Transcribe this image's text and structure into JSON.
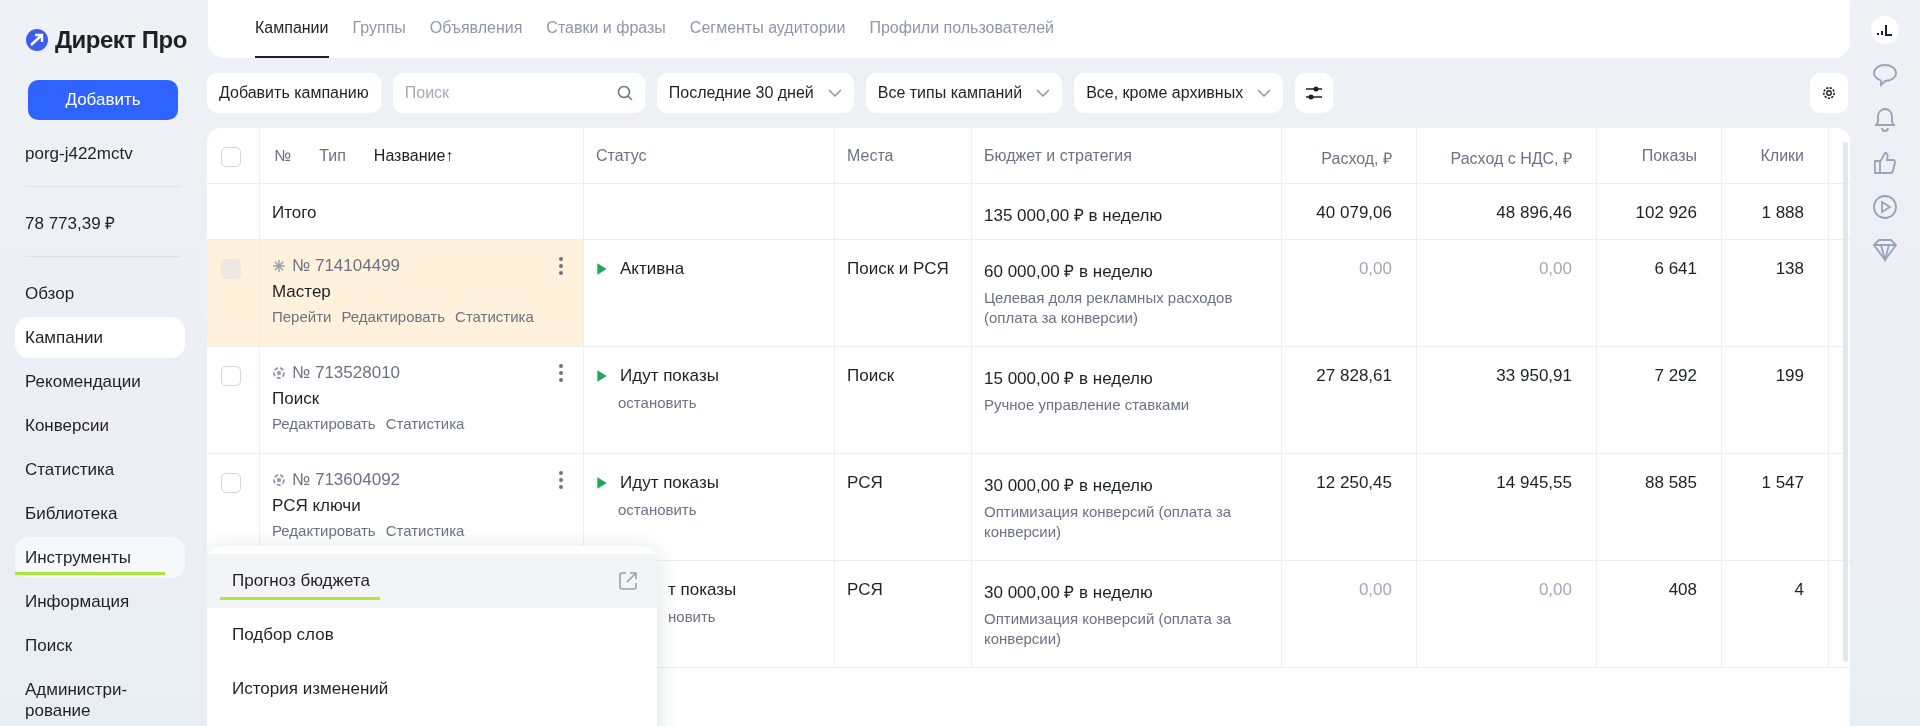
{
  "sidebar": {
    "logo": "Директ Про",
    "add_button": "Добавить",
    "account": "porg-j422mctv",
    "balance": "78 773,39 ₽",
    "items": [
      {
        "label": "Обзор",
        "selected": false,
        "open": false
      },
      {
        "label": "Кампании",
        "selected": true,
        "open": false
      },
      {
        "label": "Рекомендации",
        "selected": false,
        "open": false
      },
      {
        "label": "Конверсии",
        "selected": false,
        "open": false
      },
      {
        "label": "Статистика",
        "selected": false,
        "open": false
      },
      {
        "label": "Библиотека",
        "selected": false,
        "open": false
      },
      {
        "label": "Инструменты",
        "selected": false,
        "open": true
      },
      {
        "label": "Информация",
        "selected": false,
        "open": false
      },
      {
        "label": "Поиск",
        "selected": false,
        "open": false
      },
      {
        "label": "Администри-рование",
        "selected": false,
        "open": false
      }
    ]
  },
  "tabs": [
    {
      "label": "Кампании",
      "selected": true
    },
    {
      "label": "Группы",
      "selected": false
    },
    {
      "label": "Объявления",
      "selected": false
    },
    {
      "label": "Ставки и фразы",
      "selected": false
    },
    {
      "label": "Сегменты аудитории",
      "selected": false
    },
    {
      "label": "Профили пользователей",
      "selected": false
    }
  ],
  "toolbar": {
    "add_campaign": "Добавить кампанию",
    "search": {
      "placeholder": "Поиск"
    },
    "filters": [
      "Последние 30 дней",
      "Все типы кампаний",
      "Все, кроме архивных"
    ]
  },
  "table": {
    "all_checked": false,
    "columns": {
      "number": "№",
      "type": "Тип",
      "name": "Название↑",
      "status": "Статус",
      "places": "Места",
      "budget": "Бюджет и стратегия",
      "spend": "Расход, ₽",
      "spend_vat": "Расход с НДС, ₽",
      "shows": "Показы",
      "clicks": "Клики"
    },
    "total": {
      "label": "Итого",
      "budget": "135 000,00 ₽ в неделю",
      "spend": "40 079,06",
      "spend_vat": "48 896,46",
      "shows": "102 926",
      "clicks": "1 888"
    },
    "rows": [
      {
        "kind": "master",
        "highlighted": true,
        "checkbox_disabled": true,
        "number": "№ 714104499",
        "name": "Мастер",
        "links": [
          "Перейти",
          "Редактировать",
          "Статистика"
        ],
        "status": "Активна",
        "places": "Поиск и РСЯ",
        "budget": "60 000,00 ₽ в неделю",
        "strategy": "Целевая доля рекламных расходов (оплата за конверсии)",
        "spend": "0,00",
        "spend_vat": "0,00",
        "zero": true,
        "shows": "6 641",
        "clicks": "138"
      },
      {
        "kind": "target",
        "highlighted": false,
        "checkbox_disabled": false,
        "number": "№ 713528010",
        "name": "Поиск",
        "links": [
          "Редактировать",
          "Статистика"
        ],
        "status": "Идут показы",
        "stop": "остановить",
        "places": "Поиск",
        "budget": "15 000,00 ₽ в неделю",
        "strategy": "Ручное управление ставками",
        "spend": "27 828,61",
        "spend_vat": "33 950,91",
        "zero": false,
        "shows": "7 292",
        "clicks": "199"
      },
      {
        "kind": "target",
        "highlighted": false,
        "checkbox_disabled": false,
        "number": "№ 713604092",
        "name": "РСЯ ключи",
        "links": [
          "Редактировать",
          "Статистика"
        ],
        "status": "Идут показы",
        "stop": "остановить",
        "places": "РСЯ",
        "budget": "30 000,00 ₽ в неделю",
        "strategy": "Оптимизация конверсий (оплата за конверсии)",
        "spend": "12 250,45",
        "spend_vat": "14 945,55",
        "zero": false,
        "shows": "88 585",
        "clicks": "1 547"
      },
      {
        "kind": "covered",
        "status": "т показы",
        "stop": "новить",
        "places": "РСЯ",
        "budget": "30 000,00 ₽ в неделю",
        "strategy": "Оптимизация конверсий (оплата за конверсии)",
        "spend": "0,00",
        "spend_vat": "0,00",
        "zero": true,
        "shows": "408",
        "clicks": "4"
      }
    ]
  },
  "menu": {
    "items": [
      {
        "label": "Прогноз бюджета",
        "highlighted": true,
        "external": true
      },
      {
        "label": "Подбор слов",
        "highlighted": false,
        "external": false
      },
      {
        "label": "История изменений",
        "highlighted": false,
        "external": false
      }
    ]
  }
}
